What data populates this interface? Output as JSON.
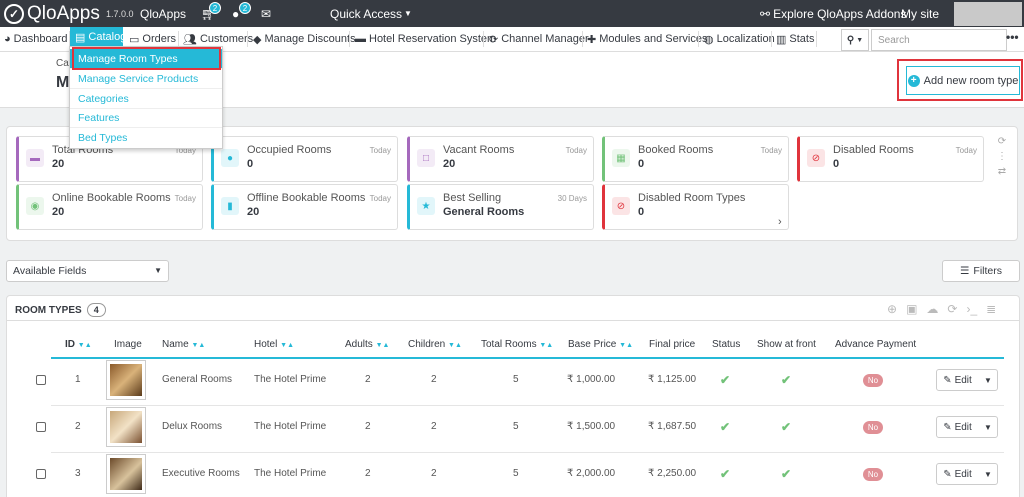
{
  "topbar": {
    "brand": "QloApps",
    "version": "1.7.0.0",
    "shop_name": "QloApps",
    "cart_badge": "2",
    "user_badge": "2",
    "quick_access": "Quick Access",
    "explore": "Explore QloApps Addons",
    "my_site": "My site"
  },
  "nav": {
    "dashboard": "Dashboard",
    "catalog": "Catalog",
    "orders": "Orders",
    "customers": "Customers",
    "manage_discounts": "Manage Discounts",
    "hotel_reservation": "Hotel Reservation System",
    "channel_manager": "Channel Manager",
    "modules": "Modules and Services",
    "localization": "Localization",
    "stats": "Stats",
    "search_placeholder": "Search"
  },
  "dropdown": {
    "items": [
      "Manage Room Types",
      "Manage Service Products",
      "Categories",
      "Features",
      "Bed Types"
    ]
  },
  "header": {
    "breadcrumb": "Cat",
    "title": "Ma",
    "add_button": "Add new room type"
  },
  "kpis": [
    {
      "title": "Total Rooms",
      "value": "20",
      "period": "Today",
      "color": "#a569bd"
    },
    {
      "title": "Occupied Rooms",
      "value": "0",
      "period": "Today",
      "color": "#25b9d7"
    },
    {
      "title": "Vacant Rooms",
      "value": "20",
      "period": "Today",
      "color": "#a569bd"
    },
    {
      "title": "Booked Rooms",
      "value": "0",
      "period": "Today",
      "color": "#72c279"
    },
    {
      "title": "Disabled Rooms",
      "value": "0",
      "period": "Today",
      "color": "#e0343c"
    },
    {
      "title": "Online Bookable Rooms",
      "value": "20",
      "period": "Today",
      "color": "#72c279"
    },
    {
      "title": "Offline Bookable Rooms",
      "value": "20",
      "period": "Today",
      "color": "#25b9d7"
    },
    {
      "title": "Best Selling",
      "value": "General Rooms",
      "period": "30 Days",
      "color": "#25b9d7"
    },
    {
      "title": "Disabled Room Types",
      "value": "0",
      "period": "",
      "color": "#e0343c"
    }
  ],
  "controls": {
    "available_fields": "Available Fields",
    "filters": "Filters"
  },
  "table": {
    "title": "ROOM TYPES",
    "count": "4",
    "headers": [
      "ID",
      "Image",
      "Name",
      "Hotel",
      "Adults",
      "Children",
      "Total Rooms",
      "Base Price",
      "Final price",
      "Status",
      "Show at front",
      "Advance Payment"
    ],
    "rows": [
      {
        "id": "1",
        "name": "General Rooms",
        "hotel": "The Hotel Prime",
        "adults": "2",
        "children": "2",
        "total": "5",
        "base": "₹ 1,000.00",
        "final": "₹ 1,125.00",
        "advance": "No",
        "edit": "Edit"
      },
      {
        "id": "2",
        "name": "Delux Rooms",
        "hotel": "The Hotel Prime",
        "adults": "2",
        "children": "2",
        "total": "5",
        "base": "₹ 1,500.00",
        "final": "₹ 1,687.50",
        "advance": "No",
        "edit": "Edit"
      },
      {
        "id": "3",
        "name": "Executive Rooms",
        "hotel": "The Hotel Prime",
        "adults": "2",
        "children": "2",
        "total": "5",
        "base": "₹ 2,000.00",
        "final": "₹ 2,250.00",
        "advance": "No",
        "edit": "Edit"
      }
    ]
  }
}
